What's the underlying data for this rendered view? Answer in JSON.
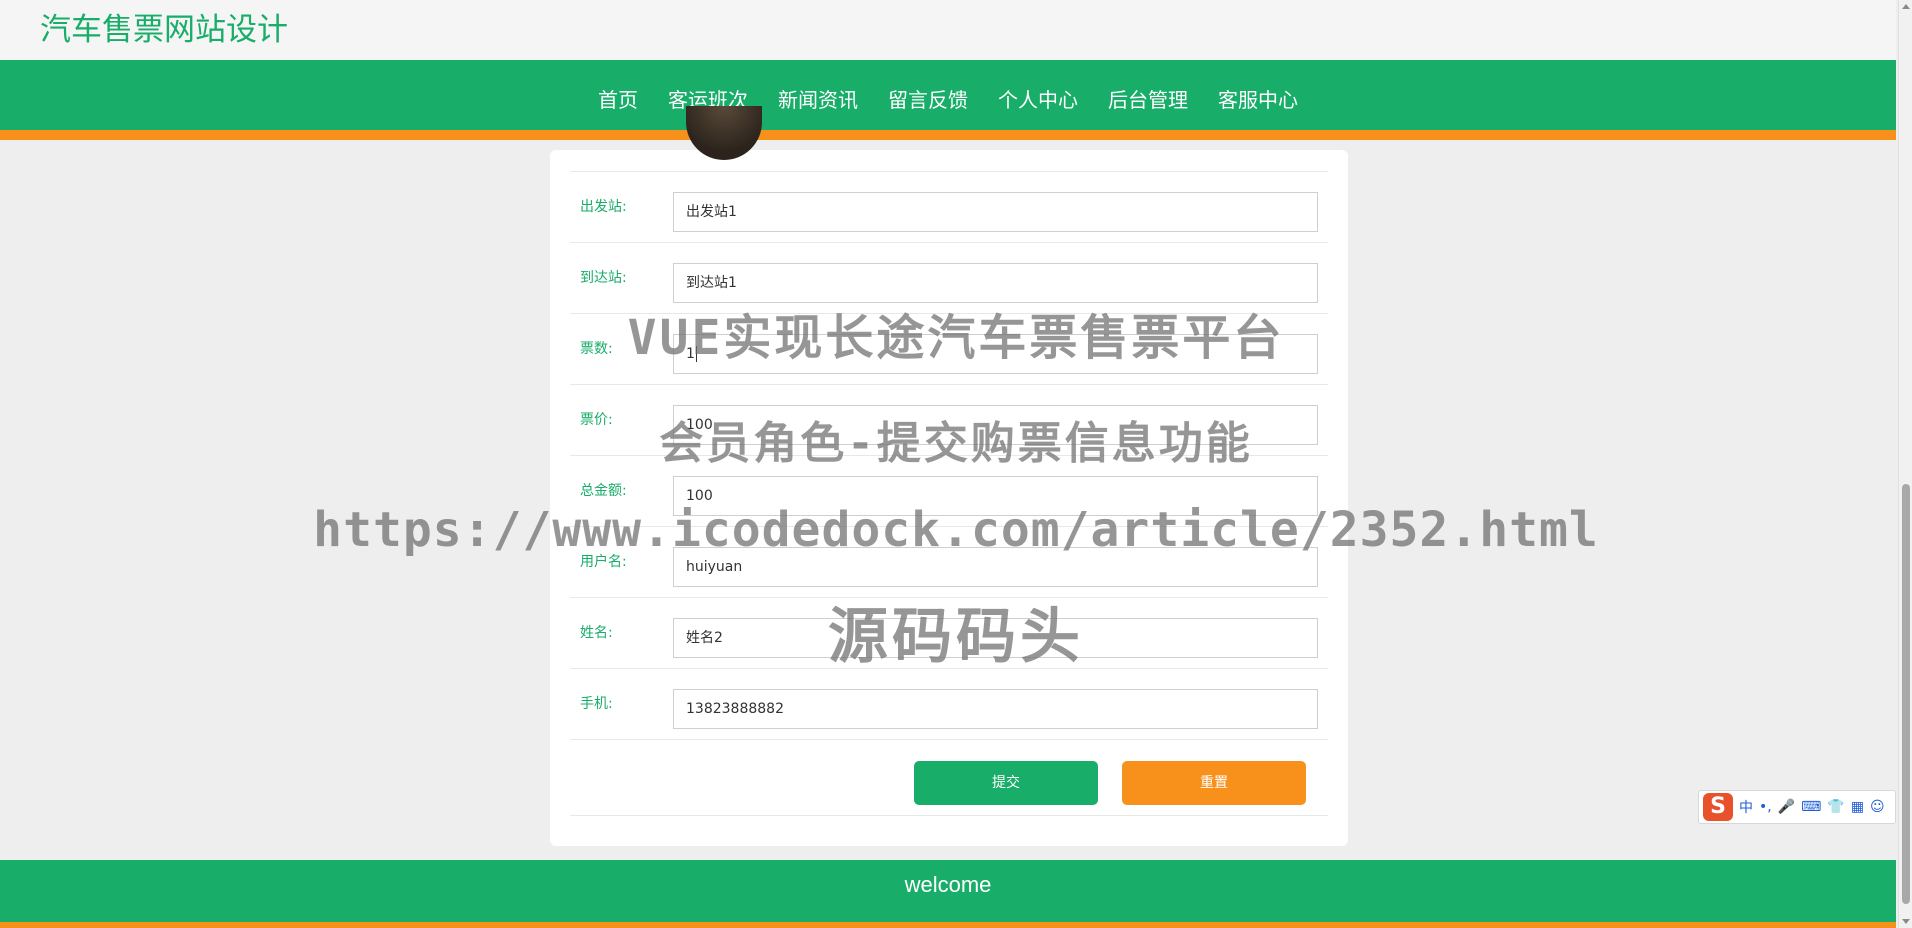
{
  "site": {
    "title": "汽车售票网站设计"
  },
  "nav": {
    "items": [
      {
        "label": "首页"
      },
      {
        "label": "客运班次"
      },
      {
        "label": "新闻资讯"
      },
      {
        "label": "留言反馈"
      },
      {
        "label": "个人中心"
      },
      {
        "label": "后台管理"
      },
      {
        "label": "客服中心"
      }
    ]
  },
  "form": {
    "fields": [
      {
        "label": "出发站:",
        "value": "出发站1"
      },
      {
        "label": "到达站:",
        "value": "到达站1"
      },
      {
        "label": "票数:",
        "value": "1"
      },
      {
        "label": "票价:",
        "value": "100"
      },
      {
        "label": "总金额:",
        "value": "100"
      },
      {
        "label": "用户名:",
        "value": "huiyuan"
      },
      {
        "label": "姓名:",
        "value": "姓名2"
      },
      {
        "label": "手机:",
        "value": "13823888882"
      }
    ],
    "submit_label": "提交",
    "reset_label": "重置"
  },
  "footer": {
    "text": "welcome"
  },
  "watermark": {
    "line1": "VUE实现长途汽车票售票平台",
    "line2": "会员角色-提交购票信息功能",
    "line3": "https://www.icodedock.com/article/2352.html",
    "line4": "源码码头"
  },
  "ime": {
    "logo": "S",
    "mode": "中",
    "punct": "•,",
    "icons": [
      "microphone-icon",
      "keyboard-icon",
      "skin-icon",
      "apps-icon",
      "avatar-icon"
    ]
  },
  "colors": {
    "brand_green": "#18ad69",
    "accent_orange": "#f7911c",
    "background": "#eeeeee"
  }
}
